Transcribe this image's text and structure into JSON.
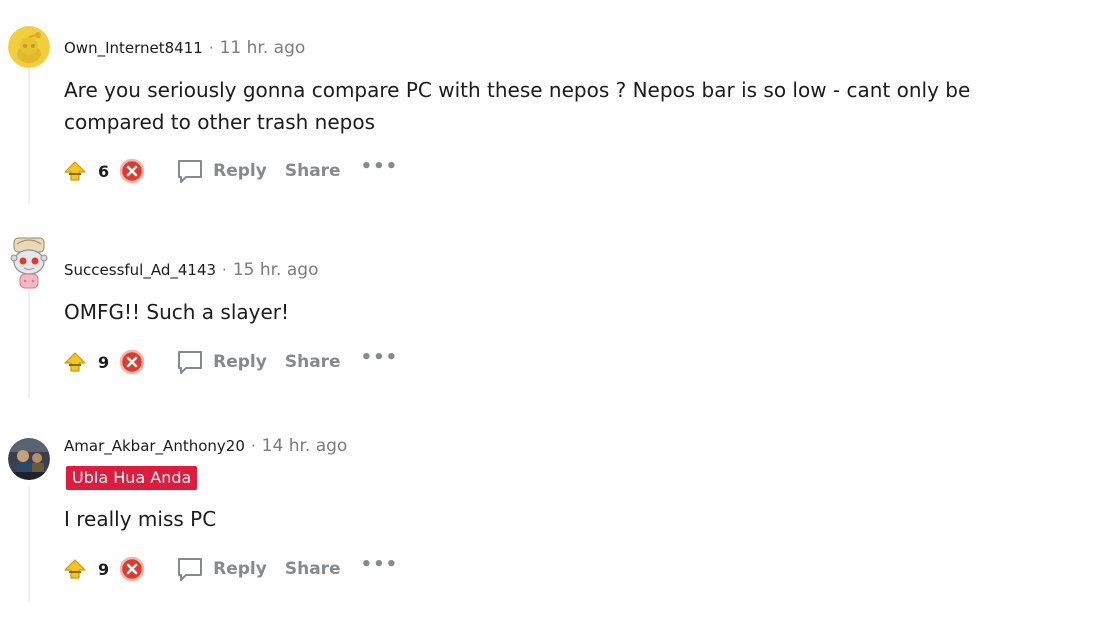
{
  "comments": [
    {
      "author": "Own_Internet8411",
      "time": "11 hr. ago",
      "flair": "",
      "text_lines": [
        "Are you seriously gonna compare PC with these nepos ? Nepos bar is so low - cant only be",
        "compared to other trash nepos"
      ],
      "score": "6",
      "avatar_icon": "snoo-yellow-avatar-icon"
    },
    {
      "author": "Successful_Ad_4143",
      "time": "15 hr. ago",
      "flair": "",
      "text_lines": [
        "OMFG!! Such a slayer!"
      ],
      "score": "9",
      "avatar_icon": "snoo-gray-avatar-icon"
    },
    {
      "author": "Amar_Akbar_Anthony20",
      "time": "14 hr. ago",
      "flair": "Ubla Hua Anda",
      "text_lines": [
        "I really miss PC"
      ],
      "score": "9",
      "avatar_icon": "photo-avatar-icon"
    }
  ],
  "actions": {
    "reply_label": "Reply",
    "share_label": "Share",
    "more_label": "•••"
  },
  "colors": {
    "upvote": "#f5c518",
    "downvote": "#e03a2e",
    "flair_bg": "#e01b3c",
    "muted": "#878a8c"
  }
}
